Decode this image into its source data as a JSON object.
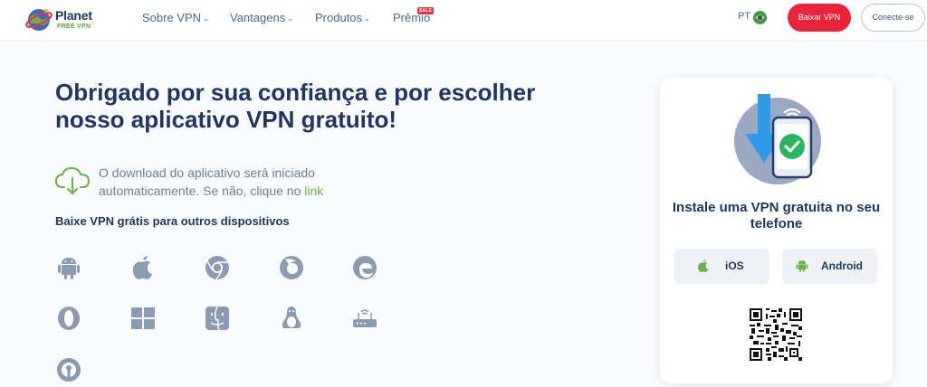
{
  "brand": {
    "name": "Planet",
    "sub": "FREE VPN"
  },
  "nav": [
    {
      "label": "Sobre VPN",
      "caret": "⌄"
    },
    {
      "label": "Vantagens",
      "caret": "⌄"
    },
    {
      "label": "Produtos",
      "caret": "⌄"
    },
    {
      "label": "Prêmio",
      "badge": "SALE"
    }
  ],
  "header": {
    "lang": "PT",
    "download_btn": "Baixar VPN",
    "login_btn": "Conecte-se"
  },
  "main": {
    "title": "Obrigado por sua confiança e por escolher nosso aplicativo VPN gratuito!",
    "download_text": "O download do aplicativo será iniciado automaticamente. Se não, clique no",
    "download_link": "link",
    "other_devices_heading": "Baixe VPN grátis para outros dispositivos",
    "devices": [
      "android-icon",
      "apple-icon",
      "chrome-icon",
      "firefox-icon",
      "edge-icon",
      "opera-icon",
      "windows-icon",
      "finder-icon",
      "linux-icon",
      "router-icon",
      "openvpn-icon"
    ]
  },
  "card": {
    "title": "Instale uma VPN gratuita no seu telefone",
    "ios_label": "iOS",
    "android_label": "Android"
  },
  "colors": {
    "accent_red": "#e8233a",
    "brand_green": "#6bb04a",
    "navy": "#1f3760",
    "icon_gray": "#8a9bb2"
  }
}
